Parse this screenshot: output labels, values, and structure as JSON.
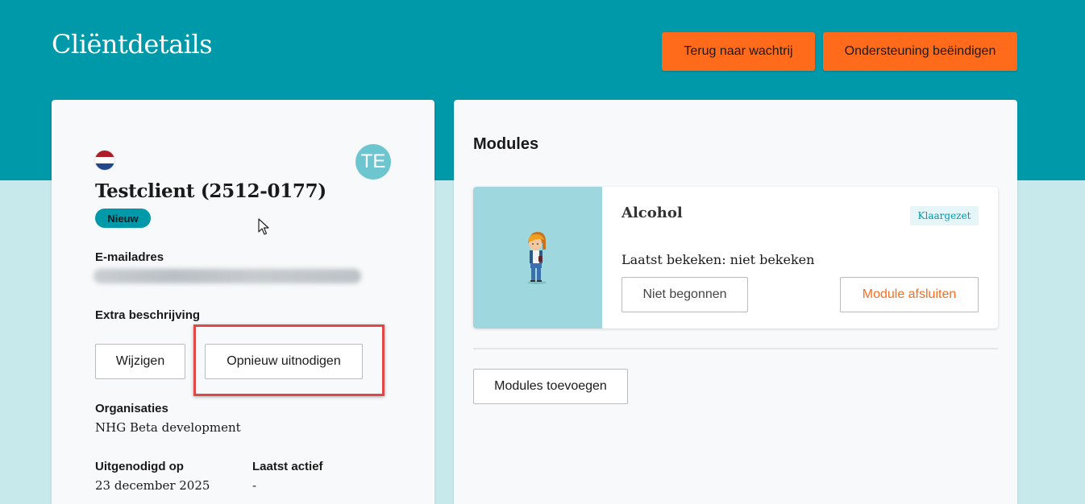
{
  "header": {
    "title": "Cliëntdetails",
    "back_button": "Terug naar wachtrij",
    "end_button": "Ondersteuning beëindigen"
  },
  "client": {
    "avatar_initials": "TE",
    "name": "Testclient (2512-0177)",
    "status_badge": "Nieuw",
    "email_label": "E-mailadres",
    "extra_description_label": "Extra beschrijving",
    "edit_button": "Wijzigen",
    "reinvite_button": "Opnieuw uitnodigen",
    "organisations_label": "Organisaties",
    "organisations_value": "NHG Beta development",
    "invited_label": "Uitgenodigd op",
    "invited_value": "23 december 2025",
    "last_active_label": "Laatst actief",
    "last_active_value": "-"
  },
  "modules": {
    "title": "Modules",
    "items": [
      {
        "name": "Alcohol",
        "status": "Klaargezet",
        "last_viewed": "Laatst bekeken: niet bekeken",
        "progress_button": "Niet begonnen",
        "close_button": "Module afsluiten"
      }
    ],
    "add_button": "Modules toevoegen"
  },
  "colors": {
    "header_bg": "#0099aa",
    "accent_orange": "#ff6b1a",
    "page_bg": "#c8e9ec",
    "highlight_red": "#e04848"
  }
}
